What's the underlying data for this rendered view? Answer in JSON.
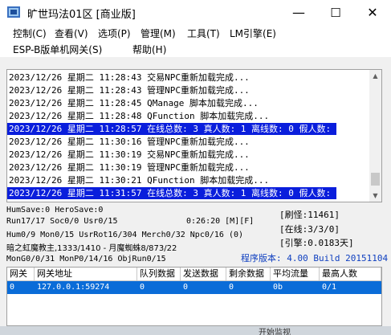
{
  "window": {
    "title": "旷世玛法01区 [商业版]",
    "controls": {
      "minimize": "—",
      "maximize": "☐",
      "close": "✕"
    }
  },
  "menu": {
    "row1": [
      "控制(C)",
      "查看(V)",
      "选项(P)",
      "管理(M)",
      "工具(T)",
      "LM引擎(E)"
    ],
    "row2": [
      "ESP-B版单机网关(S)",
      "帮助(H)"
    ]
  },
  "log": {
    "lines": [
      {
        "text": "2023/12/26 星期二 11:28:43 交易NPC重新加载完成...",
        "highlight": false
      },
      {
        "text": "2023/12/26 星期二 11:28:43 管理NPC重新加载完成...",
        "highlight": false
      },
      {
        "text": "2023/12/26 星期二 11:28:45 QManage 脚本加载完成...",
        "highlight": false
      },
      {
        "text": "2023/12/26 星期二 11:28:48 QFunction 脚本加载完成...",
        "highlight": false
      },
      {
        "text": "2023/12/26 星期二 11:28:57 在线总数: 3 真人数: 1 离线数: 0 假人数: 2",
        "highlight": true
      },
      {
        "text": "2023/12/26 星期二 11:30:16 管理NPC重新加载完成...",
        "highlight": false
      },
      {
        "text": "2023/12/26 星期二 11:30:19 交易NPC重新加载完成...",
        "highlight": false
      },
      {
        "text": "2023/12/26 星期二 11:30:19 管理NPC重新加载完成...",
        "highlight": false
      },
      {
        "text": "2023/12/26 星期二 11:30:21 QFunction 脚本加载完成...",
        "highlight": false
      },
      {
        "text": "2023/12/26 星期二 11:31:57 在线总数: 3 真人数: 1 离线数: 0 假人数: 2",
        "highlight": true
      }
    ]
  },
  "status": {
    "line1": "HumSave:0 HeroSave:0",
    "line2": "Run17/17 Soc0/0 Usr0/15",
    "runtime": "0:26:20 [M][F]",
    "line3": "Hum0/9 Mon0/15 UsrRot16/304 Merch0/32 Npc0/16 (0)",
    "line4": "暗之虹魔教主,1333/1410 - 月魔蜘蛛8/873/22",
    "line5": "MonG0/0/31 MonP0/14/16 ObjRun0/15",
    "refresh": "[刷怪:11461]",
    "online": "[在线:3/3/0]",
    "engine": "[引擎:0.0183天]",
    "version": "程序版本: 4.00 Build 20151104"
  },
  "table": {
    "headers": [
      "网关",
      "网关地址",
      "队列数据",
      "发送数据",
      "剩余数据",
      "平均流量",
      "最高人数"
    ],
    "rows": [
      [
        "0",
        "127.0.0.1:59274",
        "0",
        "0",
        "0",
        "0b",
        "0/1"
      ]
    ]
  },
  "footer": {
    "hint": "开始监视"
  },
  "colors": {
    "highlight": "#0a1edc",
    "selected_row": "#0a6cd8",
    "version_text": "#1040c0"
  }
}
